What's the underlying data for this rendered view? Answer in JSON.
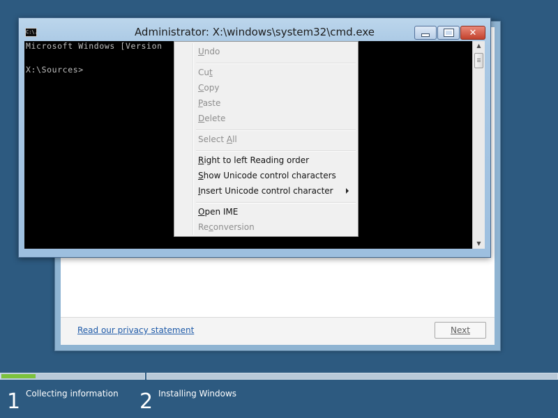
{
  "setup": {
    "privacy_link": "Read our privacy statement",
    "next_button": "Next"
  },
  "cmd": {
    "title": "Administrator: X:\\windows\\system32\\cmd.exe",
    "icon": "cmd-app-icon",
    "icon_text": "C:\\.",
    "lines": [
      "Microsoft Windows [Version",
      "",
      "X:\\Sources>"
    ],
    "close_glyph": "✕"
  },
  "context_menu": {
    "items": [
      {
        "pre": "",
        "key": "U",
        "post": "ndo",
        "enabled": false
      },
      {
        "pre": "Cu",
        "key": "t",
        "post": "",
        "enabled": false
      },
      {
        "pre": "",
        "key": "C",
        "post": "opy",
        "enabled": false
      },
      {
        "pre": "",
        "key": "P",
        "post": "aste",
        "enabled": false
      },
      {
        "pre": "",
        "key": "D",
        "post": "elete",
        "enabled": false
      },
      {
        "pre": "Select ",
        "key": "A",
        "post": "ll",
        "enabled": false
      },
      {
        "pre": "",
        "key": "R",
        "post": "ight to left Reading order",
        "enabled": true
      },
      {
        "pre": "",
        "key": "S",
        "post": "how Unicode control characters",
        "enabled": true
      },
      {
        "pre": "",
        "key": "I",
        "post": "nsert Unicode control character",
        "enabled": true,
        "submenu": true
      },
      {
        "pre": "",
        "key": "O",
        "post": "pen IME",
        "enabled": true
      },
      {
        "pre": "Re",
        "key": "c",
        "post": "onversion",
        "enabled": false
      }
    ]
  },
  "progress": {
    "steps": [
      {
        "number": "1",
        "label": "Collecting information"
      },
      {
        "number": "2",
        "label": "Installing Windows"
      }
    ],
    "step1_progress": 0.24,
    "accent_color": "#7cc23c"
  },
  "colors": {
    "desktop": "#2d5a80",
    "console_bg": "#000000",
    "console_text": "#c0c0c0"
  }
}
